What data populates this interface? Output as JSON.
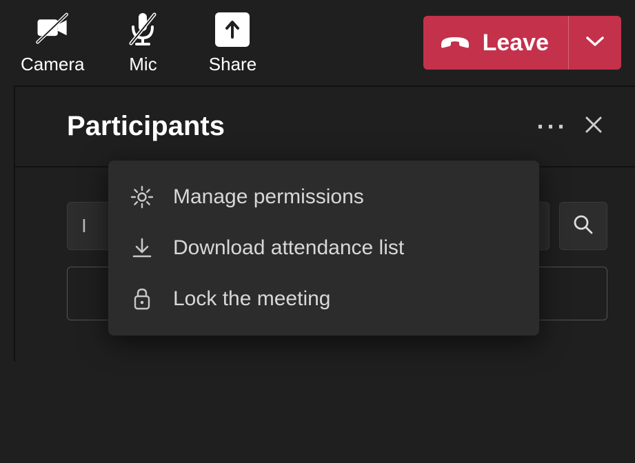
{
  "toolbar": {
    "camera_label": "Camera",
    "mic_label": "Mic",
    "share_label": "Share",
    "leave_label": "Leave"
  },
  "panel": {
    "title": "Participants",
    "input_preview": "I"
  },
  "menu": {
    "items": [
      {
        "label": "Manage permissions"
      },
      {
        "label": "Download attendance list"
      },
      {
        "label": "Lock the meeting"
      }
    ]
  },
  "colors": {
    "leave_bg": "#c4314b"
  }
}
